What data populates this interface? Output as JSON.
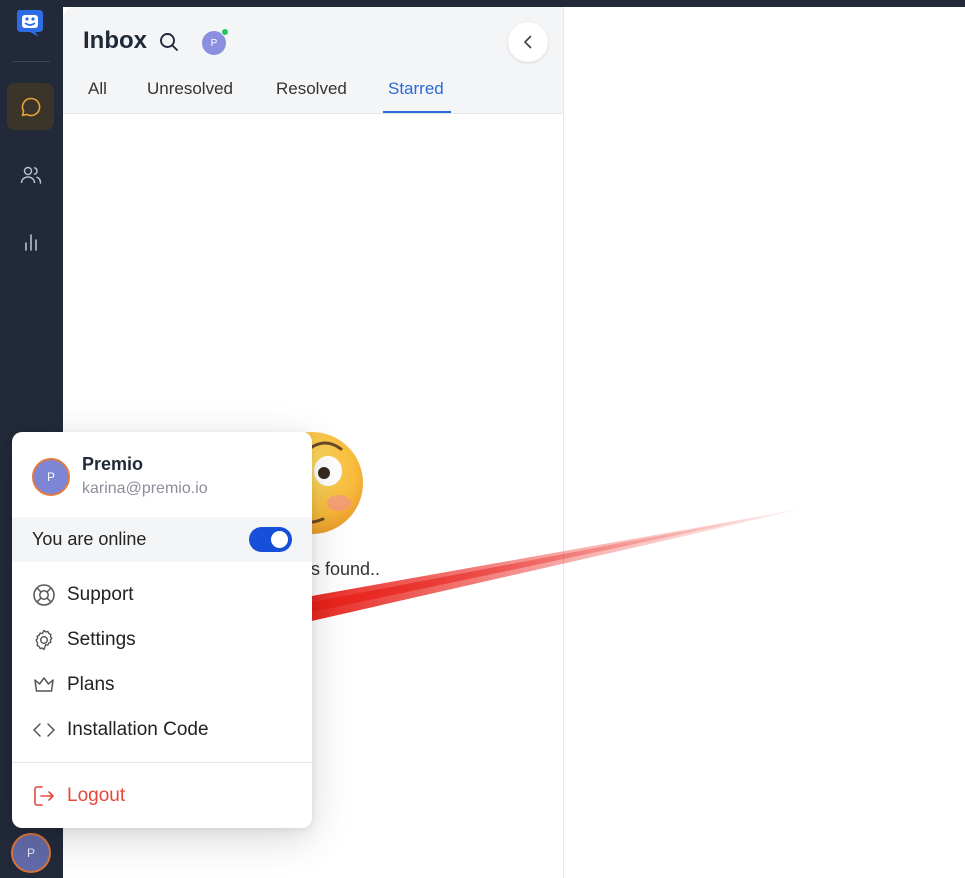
{
  "sidebar": {
    "items": [
      {
        "name": "chat-icon"
      },
      {
        "name": "contacts-icon"
      },
      {
        "name": "analytics-icon"
      }
    ],
    "avatar_initial": "P"
  },
  "inbox": {
    "title": "Inbox",
    "avatar_initial": "P",
    "tabs": [
      {
        "label": "All"
      },
      {
        "label": "Unresolved"
      },
      {
        "label": "Resolved"
      },
      {
        "label": "Starred",
        "active": true
      }
    ],
    "empty_text": "s found.."
  },
  "user_menu": {
    "avatar_initial": "P",
    "name": "Premio",
    "email": "karina@premio.io",
    "online_label": "You are online",
    "online": true,
    "items": [
      {
        "label": "Support",
        "icon": "lifebuoy-icon"
      },
      {
        "label": "Settings",
        "icon": "gear-icon"
      },
      {
        "label": "Plans",
        "icon": "crown-icon"
      },
      {
        "label": "Installation Code",
        "icon": "code-icon"
      }
    ],
    "logout_label": "Logout"
  },
  "colors": {
    "sidebar_bg": "#222a3a",
    "accent": "#2a6ad6",
    "toggle": "#1650d8",
    "logout": "#e5483b",
    "arrow": "#e8201a"
  }
}
